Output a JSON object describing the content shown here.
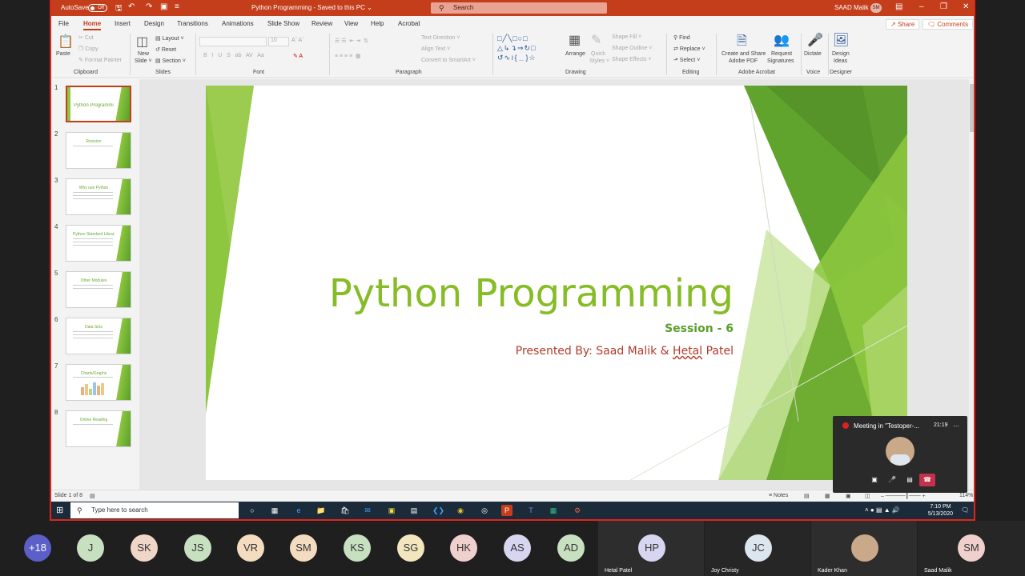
{
  "titlebar": {
    "autosave_label": "AutoSave",
    "autosave_state": "Off",
    "doc_title": "Python Programming  -  Saved to this PC  ⌄",
    "search_placeholder": "Search",
    "user_name": "SAAD Malik",
    "user_initials": "SM"
  },
  "tabs": [
    "File",
    "Home",
    "Insert",
    "Design",
    "Transitions",
    "Animations",
    "Slide Show",
    "Review",
    "View",
    "Help",
    "Acrobat"
  ],
  "active_tab": "Home",
  "share_label": "Share",
  "comments_label": "Comments",
  "ribbon": {
    "clipboard": {
      "paste": "Paste",
      "cut": "Cut",
      "copy": "Copy",
      "format_painter": "Format Painter",
      "group": "Clipboard"
    },
    "slides": {
      "new_slide": "New",
      "new_slide2": "Slide ˅",
      "layout": "Layout ˅",
      "reset": "Reset",
      "section": "Section ˅",
      "group": "Slides"
    },
    "font": {
      "size": "10",
      "group": "Font"
    },
    "paragraph": {
      "text_direction": "Text Direction ˅",
      "align_text": "Align Text ˅",
      "convert": "Convert to SmartArt ˅",
      "group": "Paragraph"
    },
    "drawing": {
      "arrange": "Arrange",
      "quick_styles": "Quick",
      "quick_styles2": "Styles ˅",
      "shape_fill": "Shape Fill ˅",
      "shape_outline": "Shape Outline ˅",
      "shape_effects": "Shape Effects ˅",
      "group": "Drawing"
    },
    "editing": {
      "find": "Find",
      "replace": "Replace ˅",
      "select": "Select ˅",
      "group": "Editing"
    },
    "acrobat": {
      "create_share": "Create and Share",
      "create_share2": "Adobe PDF",
      "request_sig": "Request",
      "request_sig2": "Signatures",
      "group": "Adobe Acrobat"
    },
    "voice": {
      "dictate": "Dictate",
      "group": "Voice"
    },
    "designer": {
      "design_ideas": "Design",
      "design_ideas2": "Ideas",
      "group": "Designer"
    }
  },
  "thumbnails": [
    {
      "num": "1",
      "title": "Python Programming"
    },
    {
      "num": "2",
      "title": "Revision"
    },
    {
      "num": "3",
      "title": "Why use Python"
    },
    {
      "num": "4",
      "title": "Python Standard Library"
    },
    {
      "num": "5",
      "title": "Other Modules"
    },
    {
      "num": "6",
      "title": "Data Sets"
    },
    {
      "num": "7",
      "title": "Charts/Graphs"
    },
    {
      "num": "8",
      "title": "Online Reading"
    }
  ],
  "slide": {
    "title": "Python Programming",
    "subtitle": "Session - 6",
    "presented_prefix": "Presented By: Saad Malik & ",
    "presented_underlined": "Hetal",
    "presented_suffix": " Patel"
  },
  "status": {
    "slide_of": "Slide 1 of 8",
    "notes": "Notes",
    "zoom": "114%"
  },
  "taskbar": {
    "search_placeholder": "Type here to search",
    "time": "7:10 PM",
    "date": "5/13/2020"
  },
  "meeting": {
    "title": "Meeting in \"Testoper-...",
    "elapsed": "21:19"
  },
  "participants": [
    {
      "initials": "+18",
      "color": "#5b5fc7"
    },
    {
      "initials": "J",
      "color": "#c7e0c0"
    },
    {
      "initials": "SK",
      "color": "#f0d6c6"
    },
    {
      "initials": "JS",
      "color": "#c7e0c0"
    },
    {
      "initials": "VR",
      "color": "#f3dcc0"
    },
    {
      "initials": "SM",
      "color": "#f3dcc0"
    },
    {
      "initials": "KS",
      "color": "#c7e0c0"
    },
    {
      "initials": "SG",
      "color": "#f3e6bf"
    },
    {
      "initials": "HK",
      "color": "#f0d0cc"
    },
    {
      "initials": "AS",
      "color": "#d6d6f0"
    },
    {
      "initials": "AD",
      "color": "#c7e0c0"
    }
  ],
  "tiles": [
    {
      "initials": "HP",
      "name": "Hetal Patel",
      "color": "#d6d6f0"
    },
    {
      "initials": "JC",
      "name": "Joy Christy",
      "color": "#dce6ee"
    },
    {
      "initials": "",
      "name": "Kader Khan",
      "color": "#c9a98a"
    },
    {
      "initials": "SM",
      "name": "Saad Malik",
      "color": "#f0d0cc"
    }
  ]
}
